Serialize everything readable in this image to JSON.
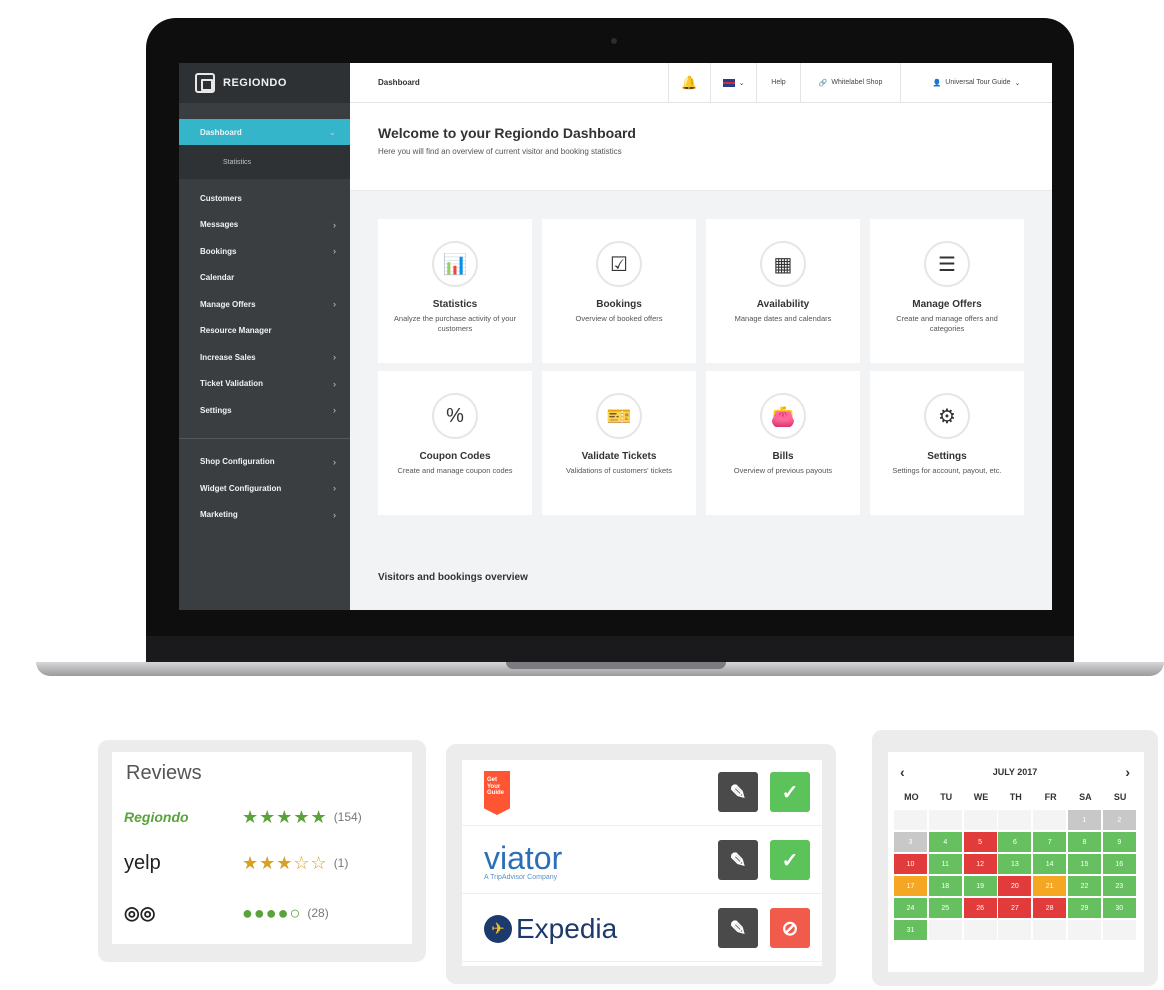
{
  "sidebar": {
    "logo": "REGIONDO",
    "active": "Dashboard",
    "sub_item": "Statistics",
    "items": [
      {
        "label": "Customers",
        "chevron": false
      },
      {
        "label": "Messages",
        "chevron": true
      },
      {
        "label": "Bookings",
        "chevron": true
      },
      {
        "label": "Calendar",
        "chevron": false
      },
      {
        "label": "Manage Offers",
        "chevron": true
      },
      {
        "label": "Resource Manager",
        "chevron": false
      },
      {
        "label": "Increase Sales",
        "chevron": true
      },
      {
        "label": "Ticket Validation",
        "chevron": true
      },
      {
        "label": "Settings",
        "chevron": true
      }
    ],
    "items2": [
      {
        "label": "Shop Configuration",
        "chevron": true
      },
      {
        "label": "Widget Configuration",
        "chevron": true
      },
      {
        "label": "Marketing",
        "chevron": true
      }
    ],
    "chevron_glyph": "›"
  },
  "header": {
    "breadcrumb": "Dashboard",
    "help": "Help",
    "whitelabel": "Whitelabel Shop",
    "user": "Universal Tour Guide"
  },
  "welcome": {
    "title": "Welcome to your Regiondo Dashboard",
    "subtitle": "Here you will find an overview of current visitor and booking statistics"
  },
  "cards": [
    {
      "title": "Statistics",
      "desc": "Analyze the purchase activity of your customers",
      "icon": "📊"
    },
    {
      "title": "Bookings",
      "desc": "Overview of booked offers",
      "icon": "☑"
    },
    {
      "title": "Availability",
      "desc": "Manage dates and calendars",
      "icon": "▦"
    },
    {
      "title": "Manage Offers",
      "desc": "Create and manage offers and categories",
      "icon": "☰"
    },
    {
      "title": "Coupon Codes",
      "desc": "Create and manage coupon codes",
      "icon": "%"
    },
    {
      "title": "Validate Tickets",
      "desc": "Validations of customers' tickets",
      "icon": "🎫"
    },
    {
      "title": "Bills",
      "desc": "Overview of previous payouts",
      "icon": "👛"
    },
    {
      "title": "Settings",
      "desc": "Settings for account, payout, etc.",
      "icon": "⚙"
    }
  ],
  "section_title": "Visitors and bookings overview",
  "reviews": {
    "title": "Reviews",
    "rows": [
      {
        "brand": "Regiondo",
        "stars": "★★★★★",
        "count": "(154)",
        "color": "#5aa33b"
      },
      {
        "brand": "yelp",
        "stars": "★★★☆☆",
        "count": "(1)",
        "color": "#d8a024"
      },
      {
        "brand": "◎◎",
        "stars": "●●●●○",
        "count": "(28)",
        "color": "#5aa33b"
      }
    ]
  },
  "channels": {
    "rows": [
      {
        "brand": "Get Your Guide",
        "status": "ok"
      },
      {
        "brand": "viator",
        "tagline": "A TripAdvisor Company",
        "status": "ok"
      },
      {
        "brand": "Expedia",
        "status": "blocked"
      }
    ],
    "edit_glyph": "✎",
    "ok_glyph": "✓",
    "no_glyph": "⊘"
  },
  "calendar": {
    "month": "JULY 2017",
    "prev": "‹",
    "next": "›",
    "days": [
      "MO",
      "TU",
      "WE",
      "TH",
      "FR",
      "SA",
      "SU"
    ],
    "colors": {
      "green": "#67c05f",
      "red": "#e23b3b",
      "orange": "#f5a623",
      "grey": "#c8c8c8",
      "empty": "#f4f4f4"
    },
    "cells": [
      {
        "d": "",
        "s": "empty"
      },
      {
        "d": "",
        "s": "empty"
      },
      {
        "d": "",
        "s": "empty"
      },
      {
        "d": "",
        "s": "empty"
      },
      {
        "d": "",
        "s": "empty"
      },
      {
        "d": "1",
        "s": "grey"
      },
      {
        "d": "2",
        "s": "grey"
      },
      {
        "d": "3",
        "s": "grey"
      },
      {
        "d": "4",
        "s": "green"
      },
      {
        "d": "5",
        "s": "red"
      },
      {
        "d": "6",
        "s": "green"
      },
      {
        "d": "7",
        "s": "green"
      },
      {
        "d": "8",
        "s": "green"
      },
      {
        "d": "9",
        "s": "green"
      },
      {
        "d": "10",
        "s": "red"
      },
      {
        "d": "11",
        "s": "green"
      },
      {
        "d": "12",
        "s": "red"
      },
      {
        "d": "13",
        "s": "green"
      },
      {
        "d": "14",
        "s": "green"
      },
      {
        "d": "15",
        "s": "green"
      },
      {
        "d": "16",
        "s": "green"
      },
      {
        "d": "17",
        "s": "orange"
      },
      {
        "d": "18",
        "s": "green"
      },
      {
        "d": "19",
        "s": "green"
      },
      {
        "d": "20",
        "s": "red"
      },
      {
        "d": "21",
        "s": "orange"
      },
      {
        "d": "22",
        "s": "green"
      },
      {
        "d": "23",
        "s": "green"
      },
      {
        "d": "24",
        "s": "green"
      },
      {
        "d": "25",
        "s": "green"
      },
      {
        "d": "26",
        "s": "red"
      },
      {
        "d": "27",
        "s": "red"
      },
      {
        "d": "28",
        "s": "red"
      },
      {
        "d": "29",
        "s": "green"
      },
      {
        "d": "30",
        "s": "green"
      },
      {
        "d": "31",
        "s": "green"
      },
      {
        "d": "",
        "s": "empty"
      },
      {
        "d": "",
        "s": "empty"
      },
      {
        "d": "",
        "s": "empty"
      },
      {
        "d": "",
        "s": "empty"
      },
      {
        "d": "",
        "s": "empty"
      },
      {
        "d": "",
        "s": "empty"
      }
    ]
  }
}
